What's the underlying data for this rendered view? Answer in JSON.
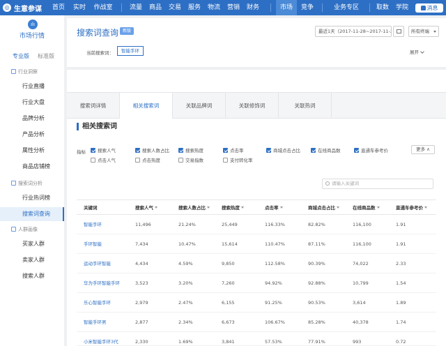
{
  "app": {
    "logo_text": "生意参谋",
    "logo_glyph": "◎"
  },
  "topnav": {
    "items": [
      {
        "label": "首页",
        "active": false
      },
      {
        "label": "实时",
        "active": false
      },
      {
        "label": "作战室",
        "active": false
      },
      {
        "label": "流量",
        "active": false
      },
      {
        "label": "商品",
        "active": false
      },
      {
        "label": "交易",
        "active": false
      },
      {
        "label": "服务",
        "active": false
      },
      {
        "label": "物流",
        "active": false
      },
      {
        "label": "营销",
        "active": false
      },
      {
        "label": "财务",
        "active": false
      },
      {
        "label": "市场",
        "active": true
      },
      {
        "label": "竞争",
        "active": false
      },
      {
        "label": "业务专区",
        "active": false
      },
      {
        "label": "取数",
        "active": false
      },
      {
        "label": "学院",
        "active": false
      }
    ],
    "message_label": "消息",
    "colors": {
      "bar": "#2d6fc4",
      "active": "#4b8ad6"
    }
  },
  "sidebar": {
    "title": "市场行情",
    "icon_glyph": "ılı",
    "version_tabs": [
      {
        "label": "专业版",
        "active": true
      },
      {
        "label": "标准版",
        "active": false
      }
    ],
    "groups": [
      {
        "label": "行业洞察",
        "items": [
          {
            "label": "行业直播"
          },
          {
            "label": "行业大盘"
          },
          {
            "label": "品牌分析"
          },
          {
            "label": "产品分析"
          },
          {
            "label": "属性分析"
          },
          {
            "label": "商品店铺榜"
          }
        ]
      },
      {
        "label": "搜索词分析",
        "items": [
          {
            "label": "行业热词榜"
          },
          {
            "label": "搜索词查询",
            "active": true
          }
        ]
      },
      {
        "label": "人群画像",
        "items": [
          {
            "label": "买家人群"
          },
          {
            "label": "卖家人群"
          },
          {
            "label": "搜索人群"
          }
        ]
      }
    ]
  },
  "header": {
    "title": "搜索词查询",
    "badge": "新版",
    "date_range": "最近1天（2017-11-28~2017-11-28）",
    "terminal": "所有终端",
    "current_kw_label": "当前搜索词：",
    "current_kw": "智能手环",
    "expand_label": "展开"
  },
  "tabs": [
    {
      "label": "搜索词详情",
      "active": false
    },
    {
      "label": "相关搜索词",
      "active": true
    },
    {
      "label": "关联品牌词",
      "active": false
    },
    {
      "label": "关联修饰词",
      "active": false
    },
    {
      "label": "关联热词",
      "active": false
    }
  ],
  "section_title": "相关搜索词",
  "indicators": {
    "label": "指标",
    "row1": [
      {
        "label": "搜索人气",
        "checked": true
      },
      {
        "label": "搜索人数占比",
        "checked": true
      },
      {
        "label": "搜索热度",
        "checked": true
      },
      {
        "label": "点击率",
        "checked": true
      },
      {
        "label": "商城点击占比",
        "checked": true
      },
      {
        "label": "在线商品数",
        "checked": true
      },
      {
        "label": "直通车参考价",
        "checked": true
      }
    ],
    "row2": [
      {
        "label": "点击人气",
        "checked": false
      },
      {
        "label": "点击热度",
        "checked": false
      },
      {
        "label": "交易指数",
        "checked": false
      },
      {
        "label": "支付转化率",
        "checked": false
      }
    ],
    "more_label": "更多 ∧"
  },
  "search": {
    "placeholder": "请输入关键词"
  },
  "table": {
    "columns": [
      "关键词",
      "搜索人气",
      "搜索人数占比",
      "搜索热度",
      "点击率",
      "商城点击占比",
      "在线商品数",
      "直通车参考价"
    ],
    "rows": [
      [
        "智能手环",
        "11,496",
        "21.24%",
        "25,449",
        "116.33%",
        "82.82%",
        "116,100",
        "1.91"
      ],
      [
        "手环智能",
        "7,434",
        "10.47%",
        "15,614",
        "110.47%",
        "87.11%",
        "116,100",
        "1.91"
      ],
      [
        "运动手环智能",
        "4,434",
        "4.59%",
        "9,850",
        "112.58%",
        "90.39%",
        "74,022",
        "2.33"
      ],
      [
        "华为手环智能手环",
        "3,523",
        "3.20%",
        "7,260",
        "94.92%",
        "92.88%",
        "10,799",
        "1.54"
      ],
      [
        "乐心智能手环",
        "2,979",
        "2.47%",
        "6,155",
        "91.25%",
        "90.53%",
        "3,614",
        "1.89"
      ],
      [
        "智能手环男",
        "2,877",
        "2.34%",
        "6,673",
        "106.67%",
        "85.28%",
        "40,378",
        "1.74"
      ],
      [
        "小米智能手环3代",
        "2,330",
        "1.69%",
        "3,841",
        "57.53%",
        "77.91%",
        "993",
        "0.72"
      ]
    ]
  }
}
